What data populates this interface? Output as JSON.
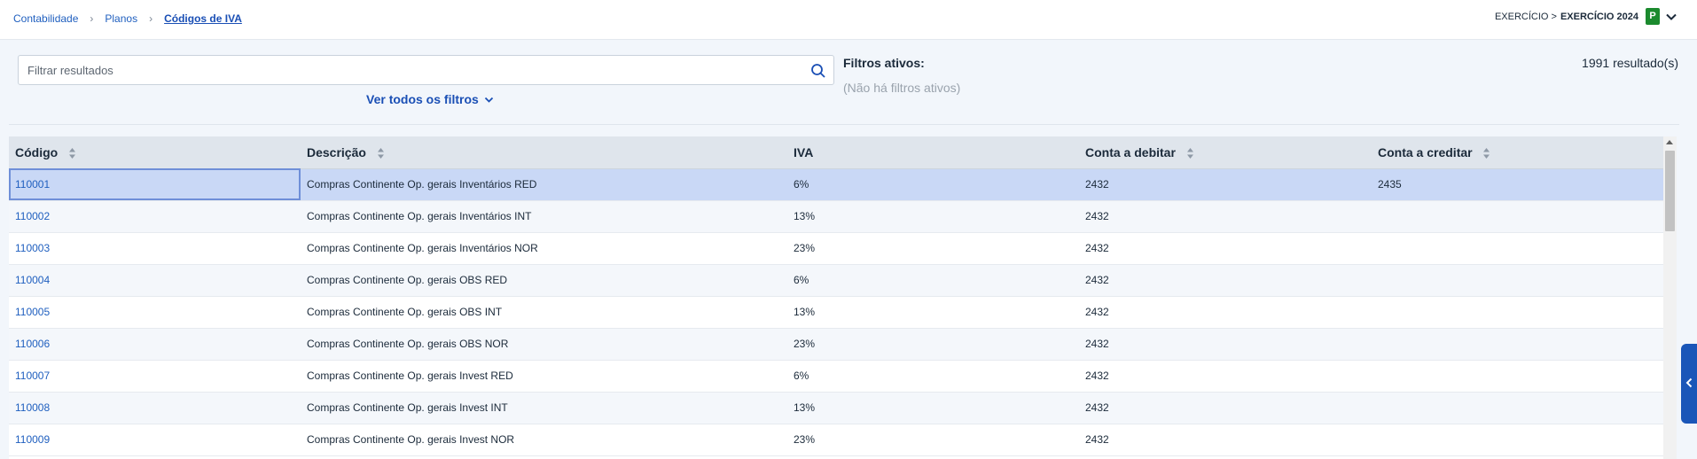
{
  "breadcrumb": {
    "items": [
      "Contabilidade",
      "Planos",
      "Códigos de IVA"
    ]
  },
  "exercise": {
    "label": "EXERCÍCIO >",
    "value": "EXERCÍCIO 2024",
    "badge": "P"
  },
  "filters": {
    "search_placeholder": "Filtrar resultados",
    "see_all_label": "Ver todos os filtros",
    "active_title": "Filtros ativos:",
    "active_none": "(Não há filtros ativos)",
    "results": "1991 resultado(s)"
  },
  "table": {
    "columns": [
      "Código",
      "Descrição",
      "IVA",
      "Conta a debitar",
      "Conta a creditar"
    ],
    "rows": [
      [
        "110001",
        "Compras Continente Op. gerais Inventários RED",
        "6%",
        "2432",
        "2435"
      ],
      [
        "110002",
        "Compras Continente Op. gerais Inventários INT",
        "13%",
        "2432",
        ""
      ],
      [
        "110003",
        "Compras Continente Op. gerais Inventários NOR",
        "23%",
        "2432",
        ""
      ],
      [
        "110004",
        "Compras Continente Op. gerais OBS RED",
        "6%",
        "2432",
        ""
      ],
      [
        "110005",
        "Compras Continente Op. gerais OBS INT",
        "13%",
        "2432",
        ""
      ],
      [
        "110006",
        "Compras Continente Op. gerais OBS NOR",
        "23%",
        "2432",
        ""
      ],
      [
        "110007",
        "Compras Continente Op. gerais Invest RED",
        "6%",
        "2432",
        ""
      ],
      [
        "110008",
        "Compras Continente Op. gerais Invest INT",
        "13%",
        "2432",
        ""
      ],
      [
        "110009",
        "Compras Continente Op. gerais Invest NOR",
        "23%",
        "2432",
        ""
      ]
    ]
  },
  "icons": {
    "search": "search-icon",
    "sort": "sort-icon",
    "chevron": "chevron-down-icon",
    "side_tab": "chevron-left-icon"
  },
  "colors": {
    "accent": "#1a4fb5",
    "badge": "#1b8a2e",
    "selected_row": "#c9d8f6"
  }
}
